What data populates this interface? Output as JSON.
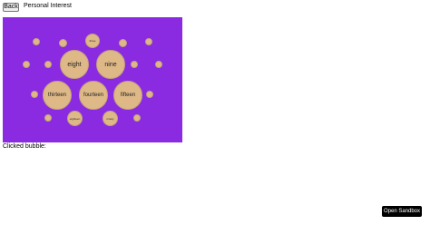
{
  "header": {
    "back_label": "Back",
    "title": "Personal Interest"
  },
  "bubbles": {
    "eight": "eight",
    "nine": "nine",
    "thirteen": "thirteen",
    "fourteen": "fourteen",
    "fifteen": "fifteen",
    "three": "three",
    "eighteen": "eighteen",
    "ninety": "ninety"
  },
  "footer": {
    "clicked_label": "Clicked bubble:",
    "open_sandbox_label": "Open Sandbox"
  },
  "colors": {
    "canvas_background": "#8a2be2",
    "bubble_fill": "#deb887"
  }
}
